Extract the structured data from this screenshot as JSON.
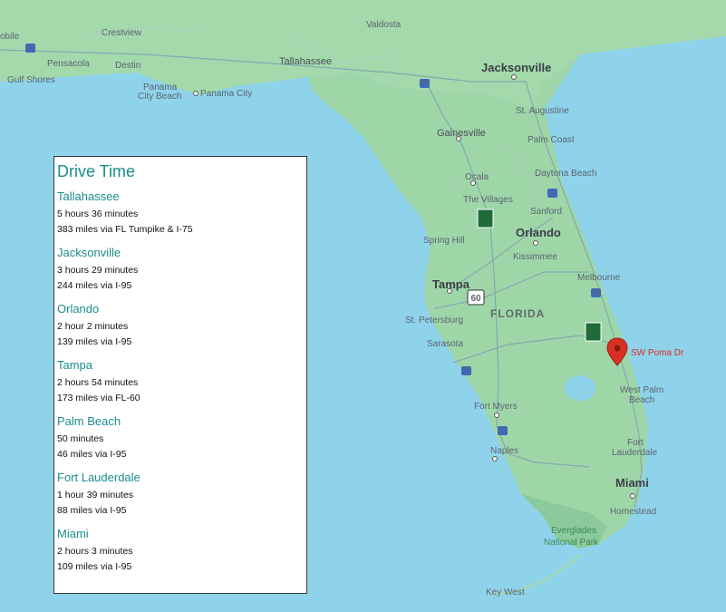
{
  "panel": {
    "title": "Drive Time",
    "destinations": [
      {
        "name": "Tallahassee",
        "time": "5 hours 36 minutes",
        "route": "383 miles via FL Tumpike & I-75"
      },
      {
        "name": "Jacksonville",
        "time": "3 hours 29 minutes",
        "route": "244 miles via I-95"
      },
      {
        "name": "Orlando",
        "time": "2 hour  2 minutes",
        "route": "139 miles via I-95"
      },
      {
        "name": "Tampa",
        "time": "2 hours 54 minutes",
        "route": "173 miles via FL-60"
      },
      {
        "name": "Palm Beach",
        "time": "50 minutes",
        "route": "46 miles via I-95"
      },
      {
        "name": "Fort Lauderdale",
        "time": "1 hour 39 minutes",
        "route": "88 miles via I-95"
      },
      {
        "name": "Miami",
        "time": "2 hours 3 minutes",
        "route": "109 miles via  I-95"
      }
    ]
  },
  "map": {
    "state_label": "FLORIDA",
    "marker_label": "SW Poma Dr",
    "marker_icon": "map-pin-icon",
    "colors": {
      "water": "#8fd3ea",
      "land": "#9fd6a8",
      "marker": "#d93025",
      "panel_heading": "#1b8c8c"
    },
    "places": {
      "mobile": "obile",
      "crestview": "Crestview",
      "valdosta": "Valdosta",
      "pensacola": "Pensacola",
      "destin": "Destin",
      "gulf_shores": "Gulf Shores",
      "panama_city_beach_1": "Panama",
      "panama_city_beach_2": "City Beach",
      "panama_city": "Panama City",
      "tallahassee": "Tallahassee",
      "jacksonville": "Jacksonville",
      "st_augustine": "St. Augustine",
      "gainesville": "Gainesville",
      "palm_coast": "Palm Coast",
      "ocala": "Ocala",
      "daytona": "Daytona Beach",
      "the_villages": "The Villages",
      "sanford": "Sanford",
      "spring_hill": "Spring Hill",
      "orlando": "Orlando",
      "kissimmee": "Kissimmee",
      "tampa": "Tampa",
      "melbourne": "Melbourne",
      "st_petersburg": "St. Petersburg",
      "sarasota": "Sarasota",
      "west_palm_1": "West Palm",
      "west_palm_2": "Beach",
      "fort_myers": "Fort Myers",
      "fort_lauderdale_1": "Fort",
      "fort_lauderdale_2": "Lauderdale",
      "naples": "Naples",
      "miami": "Miami",
      "homestead": "Homestead",
      "everglades_1": "Everglades",
      "everglades_2": "National Park",
      "key_west": "Key West"
    },
    "shields": {
      "i10": "10",
      "i75a": "75",
      "i4": "4",
      "i95": "95",
      "i75b": "75",
      "i75c": "75",
      "fl60": "60"
    }
  }
}
